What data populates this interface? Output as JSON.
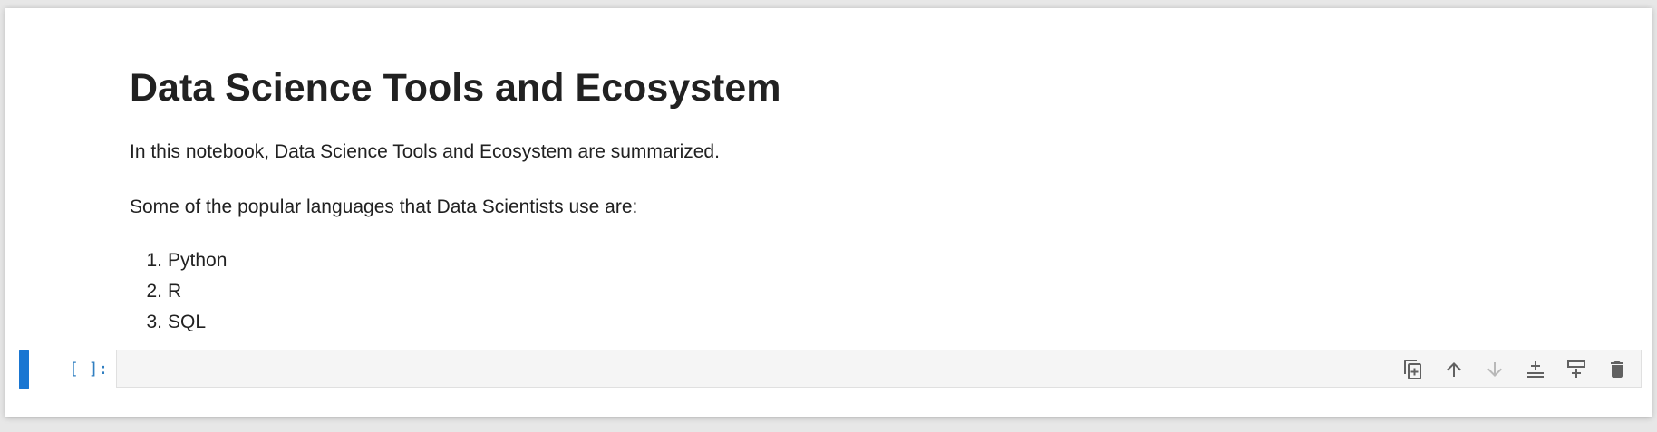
{
  "markdown": {
    "title": "Data Science Tools and Ecosystem",
    "intro": "In this notebook, Data Science Tools and Ecosystem are summarized.",
    "languages_intro": "Some of the popular languages that Data Scientists use are:",
    "languages": [
      {
        "num": "1.",
        "label": "Python"
      },
      {
        "num": "2.",
        "label": "R"
      },
      {
        "num": "3.",
        "label": "SQL"
      }
    ]
  },
  "code_cell": {
    "prompt": "[ ]:",
    "content": ""
  },
  "toolbar": {
    "icons": [
      "duplicate-icon",
      "move-up-icon",
      "move-down-icon",
      "insert-below-icon",
      "insert-above-icon",
      "delete-icon"
    ]
  },
  "colors": {
    "accent": "#1976d2",
    "prompt": "#307fc1",
    "editor_bg": "#f5f5f5"
  }
}
